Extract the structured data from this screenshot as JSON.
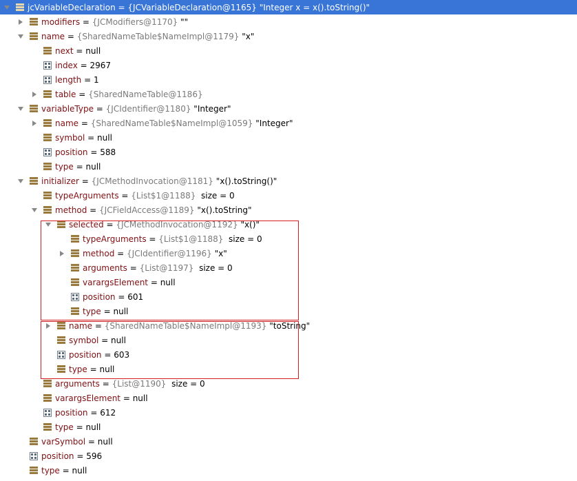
{
  "colors": {
    "selection": "#3875d7",
    "field_name": "#7f0f13",
    "type_gray": "#7a7a7a",
    "highlight_box": "#d21e1e",
    "object_icon": "#9a7a3c"
  },
  "rows": [
    {
      "depth": 0,
      "arrow": "expanded",
      "icon": "object-icon",
      "name": "jcVariableDeclaration",
      "type": "{JCVariableDeclaration@1165}",
      "value": "\"Integer x = x().toString()\"",
      "selected": true
    },
    {
      "depth": 1,
      "arrow": "collapsed",
      "icon": "object-icon",
      "name": "modifiers",
      "type": "{JCModifiers@1170}",
      "value": "\"\""
    },
    {
      "depth": 1,
      "arrow": "expanded",
      "icon": "object-icon",
      "name": "name",
      "type": "{SharedNameTable$NameImpl@1179}",
      "value": "\"x\""
    },
    {
      "depth": 2,
      "arrow": "none",
      "icon": "object-icon",
      "name": "next",
      "value": "null"
    },
    {
      "depth": 2,
      "arrow": "none",
      "icon": "primitive-icon",
      "name": "index",
      "value": "2967"
    },
    {
      "depth": 2,
      "arrow": "none",
      "icon": "primitive-icon",
      "name": "length",
      "value": "1"
    },
    {
      "depth": 2,
      "arrow": "collapsed",
      "icon": "object-icon",
      "name": "table",
      "type": "{SharedNameTable@1186}",
      "value": ""
    },
    {
      "depth": 1,
      "arrow": "expanded",
      "icon": "object-icon",
      "name": "variableType",
      "type": "{JCIdentifier@1180}",
      "value": "\"Integer\""
    },
    {
      "depth": 2,
      "arrow": "collapsed",
      "icon": "object-icon",
      "name": "name",
      "type": "{SharedNameTable$NameImpl@1059}",
      "value": "\"Integer\""
    },
    {
      "depth": 2,
      "arrow": "none",
      "icon": "object-icon",
      "name": "symbol",
      "value": "null"
    },
    {
      "depth": 2,
      "arrow": "none",
      "icon": "primitive-icon",
      "name": "position",
      "value": "588"
    },
    {
      "depth": 2,
      "arrow": "none",
      "icon": "object-icon",
      "name": "type",
      "value": "null"
    },
    {
      "depth": 1,
      "arrow": "expanded",
      "icon": "object-icon",
      "name": "initializer",
      "type": "{JCMethodInvocation@1181}",
      "value": "\"x().toString()\""
    },
    {
      "depth": 2,
      "arrow": "none",
      "icon": "object-icon",
      "name": "typeArguments",
      "type": "{List$1@1188}",
      "value": " size = 0"
    },
    {
      "depth": 2,
      "arrow": "expanded",
      "icon": "object-icon",
      "name": "method",
      "type": "{JCFieldAccess@1189}",
      "value": "\"x().toString\""
    },
    {
      "depth": 3,
      "arrow": "expanded",
      "icon": "object-icon",
      "name": "selected",
      "type": "{JCMethodInvocation@1192}",
      "value": "\"x()\""
    },
    {
      "depth": 4,
      "arrow": "none",
      "icon": "object-icon",
      "name": "typeArguments",
      "type": "{List$1@1188}",
      "value": " size = 0"
    },
    {
      "depth": 4,
      "arrow": "collapsed",
      "icon": "object-icon",
      "name": "method",
      "type": "{JCIdentifier@1196}",
      "value": "\"x\""
    },
    {
      "depth": 4,
      "arrow": "none",
      "icon": "object-icon",
      "name": "arguments",
      "type": "{List@1197}",
      "value": " size = 0"
    },
    {
      "depth": 4,
      "arrow": "none",
      "icon": "object-icon",
      "name": "varargsElement",
      "value": "null"
    },
    {
      "depth": 4,
      "arrow": "none",
      "icon": "primitive-icon",
      "name": "position",
      "value": "601"
    },
    {
      "depth": 4,
      "arrow": "none",
      "icon": "object-icon",
      "name": "type",
      "value": "null"
    },
    {
      "depth": 3,
      "arrow": "collapsed",
      "icon": "object-icon",
      "name": "name",
      "type": "{SharedNameTable$NameImpl@1193}",
      "value": "\"toString\""
    },
    {
      "depth": 3,
      "arrow": "none",
      "icon": "object-icon",
      "name": "symbol",
      "value": "null"
    },
    {
      "depth": 3,
      "arrow": "none",
      "icon": "primitive-icon",
      "name": "position",
      "value": "603"
    },
    {
      "depth": 3,
      "arrow": "none",
      "icon": "object-icon",
      "name": "type",
      "value": "null"
    },
    {
      "depth": 2,
      "arrow": "none",
      "icon": "object-icon",
      "name": "arguments",
      "type": "{List@1190}",
      "value": " size = 0"
    },
    {
      "depth": 2,
      "arrow": "none",
      "icon": "object-icon",
      "name": "varargsElement",
      "value": "null"
    },
    {
      "depth": 2,
      "arrow": "none",
      "icon": "primitive-icon",
      "name": "position",
      "value": "612"
    },
    {
      "depth": 2,
      "arrow": "none",
      "icon": "object-icon",
      "name": "type",
      "value": "null"
    },
    {
      "depth": 1,
      "arrow": "none",
      "icon": "object-icon",
      "name": "varSymbol",
      "value": "null"
    },
    {
      "depth": 1,
      "arrow": "none",
      "icon": "primitive-icon",
      "name": "position",
      "value": "596"
    },
    {
      "depth": 1,
      "arrow": "none",
      "icon": "object-icon",
      "name": "type",
      "value": "null"
    }
  ]
}
